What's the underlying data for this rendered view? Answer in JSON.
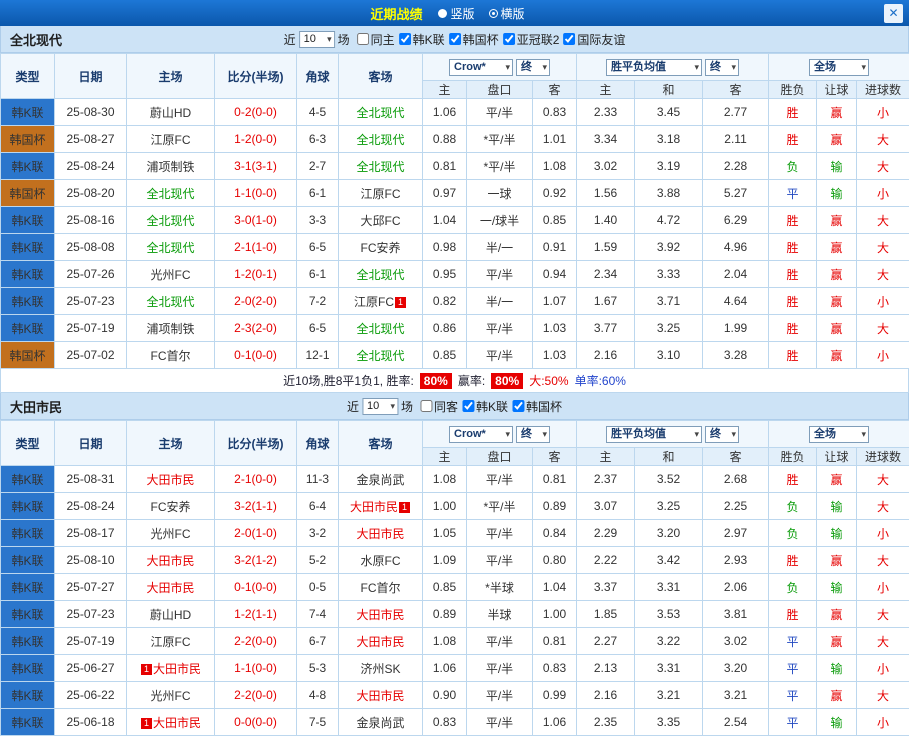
{
  "topbar": {
    "title": "近期战绩",
    "radios": [
      {
        "label": "竖版",
        "selected": false
      },
      {
        "label": "横版",
        "selected": true
      }
    ],
    "close_icon": "✕"
  },
  "filter_labels": {
    "near": "近",
    "games": "场"
  },
  "table_header": {
    "type": "类型",
    "date": "日期",
    "home": "主场",
    "score": "比分(半场)",
    "corner": "角球",
    "away": "客场",
    "odds_select": "Crow*",
    "final_label": "终",
    "europe_select": "胜平负均值",
    "fulltime_select": "全场",
    "sub": {
      "home": "主",
      "handicap": "盘口",
      "away": "客",
      "e_home": "主",
      "e_draw": "和",
      "e_away": "客",
      "result": "胜负",
      "cover": "让球",
      "goals": "进球数"
    }
  },
  "colors": {
    "league": {
      "韩K联": "#2b76cc",
      "韩国杯": "#c2701e"
    },
    "results": {
      "胜": "#e60000",
      "平": "#2148c0",
      "负": "#089b08",
      "赢": "#e60000",
      "输": "#089b08",
      "大": "#e60000",
      "小": "#e60000"
    },
    "score": "#e60000"
  },
  "sections": [
    {
      "team": "全北现代",
      "accent": "#089b08",
      "filter": {
        "count": "10",
        "checkboxes": [
          {
            "label": "同主",
            "checked": false
          },
          {
            "label": "韩K联",
            "checked": true
          },
          {
            "label": "韩国杯",
            "checked": true
          },
          {
            "label": "亚冠联2",
            "checked": true
          },
          {
            "label": "国际友谊",
            "checked": true
          }
        ]
      },
      "rows": [
        {
          "league": "韩K联",
          "date": "25-08-30",
          "home": {
            "name": "蔚山HD"
          },
          "score": "0-2(0-0)",
          "corner": "4-5",
          "away": {
            "name": "全北现代",
            "focus": true
          },
          "asia": [
            "1.06",
            "平/半",
            "0.83"
          ],
          "europe": [
            "2.33",
            "3.45",
            "2.77"
          ],
          "result": "胜",
          "cover": "赢",
          "goals": "小"
        },
        {
          "league": "韩国杯",
          "date": "25-08-27",
          "home": {
            "name": "江原FC"
          },
          "score": "1-2(0-0)",
          "corner": "6-3",
          "away": {
            "name": "全北现代",
            "focus": true
          },
          "asia": [
            "0.88",
            "*平/半",
            "1.01"
          ],
          "europe": [
            "3.34",
            "3.18",
            "2.11"
          ],
          "result": "胜",
          "cover": "赢",
          "goals": "大"
        },
        {
          "league": "韩K联",
          "date": "25-08-24",
          "home": {
            "name": "浦项制铁"
          },
          "score": "3-1(3-1)",
          "corner": "2-7",
          "away": {
            "name": "全北现代",
            "focus": true
          },
          "asia": [
            "0.81",
            "*平/半",
            "1.08"
          ],
          "europe": [
            "3.02",
            "3.19",
            "2.28"
          ],
          "result": "负",
          "cover": "输",
          "goals": "大"
        },
        {
          "league": "韩国杯",
          "date": "25-08-20",
          "home": {
            "name": "全北现代",
            "focus": true
          },
          "score": "1-1(0-0)",
          "corner": "6-1",
          "away": {
            "name": "江原FC"
          },
          "asia": [
            "0.97",
            "一球",
            "0.92"
          ],
          "europe": [
            "1.56",
            "3.88",
            "5.27"
          ],
          "result": "平",
          "cover": "输",
          "goals": "小"
        },
        {
          "league": "韩K联",
          "date": "25-08-16",
          "home": {
            "name": "全北现代",
            "focus": true
          },
          "score": "3-0(1-0)",
          "corner": "3-3",
          "away": {
            "name": "大邱FC"
          },
          "asia": [
            "1.04",
            "一/球半",
            "0.85"
          ],
          "europe": [
            "1.40",
            "4.72",
            "6.29"
          ],
          "result": "胜",
          "cover": "赢",
          "goals": "大"
        },
        {
          "league": "韩K联",
          "date": "25-08-08",
          "home": {
            "name": "全北现代",
            "focus": true
          },
          "score": "2-1(1-0)",
          "corner": "6-5",
          "away": {
            "name": "FC安养"
          },
          "asia": [
            "0.98",
            "半/一",
            "0.91"
          ],
          "europe": [
            "1.59",
            "3.92",
            "4.96"
          ],
          "result": "胜",
          "cover": "赢",
          "goals": "大"
        },
        {
          "league": "韩K联",
          "date": "25-07-26",
          "home": {
            "name": "光州FC"
          },
          "score": "1-2(0-1)",
          "corner": "6-1",
          "away": {
            "name": "全北现代",
            "focus": true
          },
          "asia": [
            "0.95",
            "平/半",
            "0.94"
          ],
          "europe": [
            "2.34",
            "3.33",
            "2.04"
          ],
          "result": "胜",
          "cover": "赢",
          "goals": "大"
        },
        {
          "league": "韩K联",
          "date": "25-07-23",
          "home": {
            "name": "全北现代",
            "focus": true
          },
          "score": "2-0(2-0)",
          "corner": "7-2",
          "away": {
            "name": "江原FC",
            "badge_after": "1"
          },
          "asia": [
            "0.82",
            "半/一",
            "1.07"
          ],
          "europe": [
            "1.67",
            "3.71",
            "4.64"
          ],
          "result": "胜",
          "cover": "赢",
          "goals": "小"
        },
        {
          "league": "韩K联",
          "date": "25-07-19",
          "home": {
            "name": "浦项制铁"
          },
          "score": "2-3(2-0)",
          "corner": "6-5",
          "away": {
            "name": "全北现代",
            "focus": true
          },
          "asia": [
            "0.86",
            "平/半",
            "1.03"
          ],
          "europe": [
            "3.77",
            "3.25",
            "1.99"
          ],
          "result": "胜",
          "cover": "赢",
          "goals": "大"
        },
        {
          "league": "韩国杯",
          "date": "25-07-02",
          "home": {
            "name": "FC首尔"
          },
          "score": "0-1(0-0)",
          "corner": "12-1",
          "away": {
            "name": "全北现代",
            "focus": true
          },
          "asia": [
            "0.85",
            "平/半",
            "1.03"
          ],
          "europe": [
            "2.16",
            "3.10",
            "3.28"
          ],
          "result": "胜",
          "cover": "赢",
          "goals": "小"
        }
      ],
      "summary": {
        "text": "近10场,胜8平1负1, 胜率:",
        "win_rate": "80%",
        "profit_label": "赢率:",
        "profit_rate": "80%",
        "big_rate": "大:50%",
        "single_rate": "单率:60%"
      }
    },
    {
      "team": "大田市民",
      "accent": "#e60000",
      "filter": {
        "count": "10",
        "checkboxes": [
          {
            "label": "同客",
            "checked": false
          },
          {
            "label": "韩K联",
            "checked": true
          },
          {
            "label": "韩国杯",
            "checked": true
          }
        ]
      },
      "rows": [
        {
          "league": "韩K联",
          "date": "25-08-31",
          "home": {
            "name": "大田市民",
            "focus": true
          },
          "score": "2-1(0-0)",
          "corner": "11-3",
          "away": {
            "name": "金泉尚武"
          },
          "asia": [
            "1.08",
            "平/半",
            "0.81"
          ],
          "europe": [
            "2.37",
            "3.52",
            "2.68"
          ],
          "result": "胜",
          "cover": "赢",
          "goals": "大"
        },
        {
          "league": "韩K联",
          "date": "25-08-24",
          "home": {
            "name": "FC安养"
          },
          "score": "3-2(1-1)",
          "corner": "6-4",
          "away": {
            "name": "大田市民",
            "focus": true,
            "badge_after": "1"
          },
          "asia": [
            "1.00",
            "*平/半",
            "0.89"
          ],
          "europe": [
            "3.07",
            "3.25",
            "2.25"
          ],
          "result": "负",
          "cover": "输",
          "goals": "大"
        },
        {
          "league": "韩K联",
          "date": "25-08-17",
          "home": {
            "name": "光州FC"
          },
          "score": "2-0(1-0)",
          "corner": "3-2",
          "away": {
            "name": "大田市民",
            "focus": true
          },
          "asia": [
            "1.05",
            "平/半",
            "0.84"
          ],
          "europe": [
            "2.29",
            "3.20",
            "2.97"
          ],
          "result": "负",
          "cover": "输",
          "goals": "小"
        },
        {
          "league": "韩K联",
          "date": "25-08-10",
          "home": {
            "name": "大田市民",
            "focus": true
          },
          "score": "3-2(1-2)",
          "corner": "5-2",
          "away": {
            "name": "水原FC"
          },
          "asia": [
            "1.09",
            "平/半",
            "0.80"
          ],
          "europe": [
            "2.22",
            "3.42",
            "2.93"
          ],
          "result": "胜",
          "cover": "赢",
          "goals": "大"
        },
        {
          "league": "韩K联",
          "date": "25-07-27",
          "home": {
            "name": "大田市民",
            "focus": true
          },
          "score": "0-1(0-0)",
          "corner": "0-5",
          "away": {
            "name": "FC首尔"
          },
          "asia": [
            "0.85",
            "*半球",
            "1.04"
          ],
          "europe": [
            "3.37",
            "3.31",
            "2.06"
          ],
          "result": "负",
          "cover": "输",
          "goals": "小"
        },
        {
          "league": "韩K联",
          "date": "25-07-23",
          "home": {
            "name": "蔚山HD"
          },
          "score": "1-2(1-1)",
          "corner": "7-4",
          "away": {
            "name": "大田市民",
            "focus": true
          },
          "asia": [
            "0.89",
            "半球",
            "1.00"
          ],
          "europe": [
            "1.85",
            "3.53",
            "3.81"
          ],
          "result": "胜",
          "cover": "赢",
          "goals": "大"
        },
        {
          "league": "韩K联",
          "date": "25-07-19",
          "home": {
            "name": "江原FC"
          },
          "score": "2-2(0-0)",
          "corner": "6-7",
          "away": {
            "name": "大田市民",
            "focus": true
          },
          "asia": [
            "1.08",
            "平/半",
            "0.81"
          ],
          "europe": [
            "2.27",
            "3.22",
            "3.02"
          ],
          "result": "平",
          "cover": "赢",
          "goals": "大"
        },
        {
          "league": "韩K联",
          "date": "25-06-27",
          "home": {
            "name": "大田市民",
            "focus": true,
            "badge_before": "1"
          },
          "score": "1-1(0-0)",
          "corner": "5-3",
          "away": {
            "name": "济州SK"
          },
          "asia": [
            "1.06",
            "平/半",
            "0.83"
          ],
          "europe": [
            "2.13",
            "3.31",
            "3.20"
          ],
          "result": "平",
          "cover": "输",
          "goals": "小"
        },
        {
          "league": "韩K联",
          "date": "25-06-22",
          "home": {
            "name": "光州FC"
          },
          "score": "2-2(0-0)",
          "corner": "4-8",
          "away": {
            "name": "大田市民",
            "focus": true
          },
          "asia": [
            "0.90",
            "平/半",
            "0.99"
          ],
          "europe": [
            "2.16",
            "3.21",
            "3.21"
          ],
          "result": "平",
          "cover": "赢",
          "goals": "大"
        },
        {
          "league": "韩K联",
          "date": "25-06-18",
          "home": {
            "name": "大田市民",
            "focus": true,
            "badge_before": "1"
          },
          "score": "0-0(0-0)",
          "corner": "7-5",
          "away": {
            "name": "金泉尚武"
          },
          "asia": [
            "0.83",
            "平/半",
            "1.06"
          ],
          "europe": [
            "2.35",
            "3.35",
            "2.54"
          ],
          "result": "平",
          "cover": "输",
          "goals": "小"
        }
      ]
    }
  ]
}
